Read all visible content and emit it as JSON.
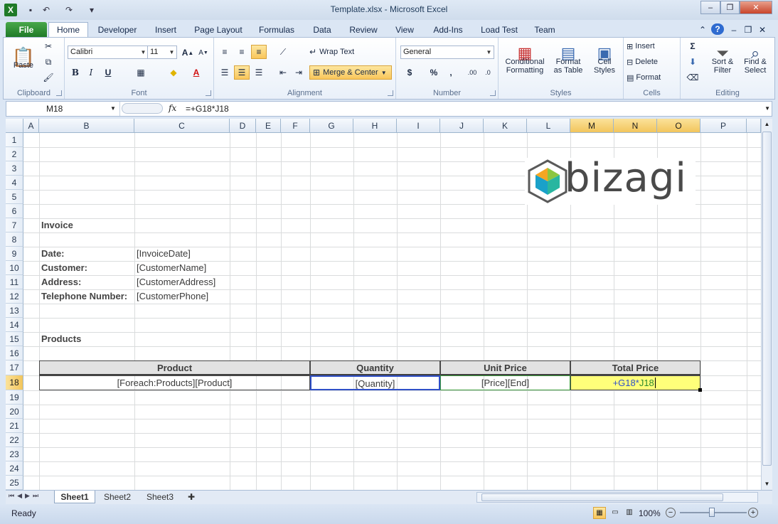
{
  "window": {
    "title": "Template.xlsx  -  Microsoft Excel",
    "minimize": "–",
    "restore": "❐",
    "close": "✕"
  },
  "tabs": [
    "File",
    "Home",
    "Developer",
    "Insert",
    "Page Layout",
    "Formulas",
    "Data",
    "Review",
    "View",
    "Add-Ins",
    "Load Test",
    "Team"
  ],
  "ribbon": {
    "clipboard": {
      "label": "Clipboard",
      "paste": "Paste"
    },
    "font": {
      "label": "Font",
      "name": "Calibri",
      "size": "11"
    },
    "alignment": {
      "label": "Alignment",
      "wrap_text": "Wrap Text",
      "merge_center": "Merge & Center"
    },
    "number": {
      "label": "Number",
      "format": "General"
    },
    "styles": {
      "label": "Styles",
      "conditional_1": "Conditional",
      "conditional_2": "Formatting",
      "format_1": "Format",
      "format_2": "as Table",
      "cell_1": "Cell",
      "cell_2": "Styles"
    },
    "cells": {
      "label": "Cells",
      "insert": "Insert",
      "delete": "Delete",
      "format": "Format"
    },
    "editing": {
      "label": "Editing",
      "sort_1": "Sort &",
      "sort_2": "Filter",
      "find_1": "Find &",
      "find_2": "Select"
    }
  },
  "formula_bar": {
    "name_box": "M18",
    "fx": "fx",
    "formula": "=+G18*J18"
  },
  "grid": {
    "columns": [
      "A",
      "B",
      "C",
      "D",
      "E",
      "F",
      "G",
      "H",
      "I",
      "J",
      "K",
      "L",
      "M",
      "N",
      "O",
      "P"
    ],
    "rows": [
      "1",
      "2",
      "3",
      "4",
      "5",
      "6",
      "7",
      "8",
      "9",
      "10",
      "11",
      "12",
      "13",
      "14",
      "15",
      "16",
      "17",
      "18",
      "19",
      "20",
      "21",
      "22",
      "23",
      "24",
      "25"
    ],
    "selected_row": "18",
    "cells": {
      "invoice": "Invoice",
      "date_label": "Date:",
      "date_value": "[InvoiceDate]",
      "customer_label": "Customer:",
      "customer_value": "[CustomerName]",
      "address_label": "Address:",
      "address_value": "[CustomerAddress]",
      "phone_label": "Telephone Number:",
      "phone_value": "[CustomerPhone]",
      "products": "Products"
    },
    "table": {
      "headers": [
        "Product",
        "Quantity",
        "Unit Price",
        "Total Price"
      ],
      "row": [
        "[Foreach:Products][Product]",
        "[Quantity]",
        "[Price][End]"
      ],
      "edit_part1": "+G18*",
      "edit_part2": "J18"
    },
    "logo_text": "bizagi"
  },
  "sheets": [
    "Sheet1",
    "Sheet2",
    "Sheet3"
  ],
  "status": {
    "ready": "Ready",
    "zoom": "100%"
  }
}
